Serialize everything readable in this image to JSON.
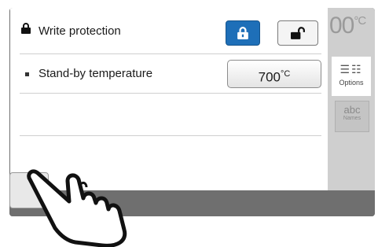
{
  "write_protection": {
    "label": "Write protection",
    "locked_button": "lock-icon",
    "unlocked_button": "unlock-icon"
  },
  "standby": {
    "label": "Stand-by temperature",
    "value": "700",
    "unit": "°C"
  },
  "right_panel": {
    "temperature": "00",
    "unit": "°C",
    "options_tab_label": "Options",
    "names_tab_glyph": "abc",
    "names_tab_label": "Names"
  },
  "colors": {
    "accent": "#1e6fb8",
    "panel": "#ffffff",
    "frame": "#6f6f6f"
  }
}
